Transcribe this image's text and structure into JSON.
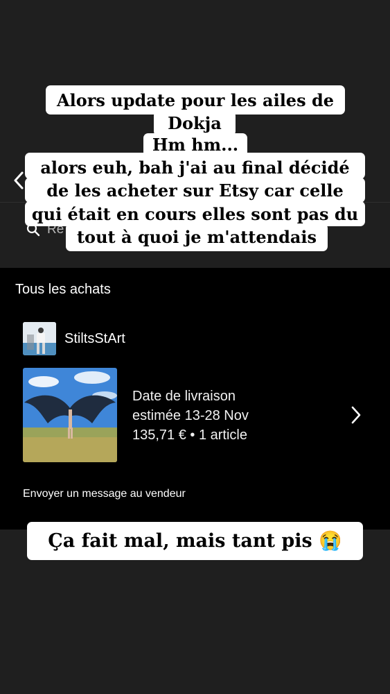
{
  "search": {
    "placeholder_visible": "Re"
  },
  "orders": {
    "section_title": "Tous les achats",
    "shop_name": "StiltsStArt",
    "delivery_line_1": "Date de livraison",
    "delivery_line_2": "estimée 13-28 Nov",
    "price_line": "135,71 € • 1 article",
    "message_seller": "Envoyer un message au vendeur"
  },
  "captions": {
    "line_1": "Alors update pour les ailes de",
    "line_2": "Dokja",
    "line_3": "Hm hm...",
    "line_4": "alors euh, bah j'ai au final décidé",
    "line_5": "de les acheter sur Etsy car celle",
    "line_6": "qui était en cours elles sont pas du",
    "line_7": "tout à quoi je m'attendais",
    "bottom": "Ça fait mal, mais tant pis 😭"
  },
  "icons": {
    "back": "chevron-left-icon",
    "search": "search-icon",
    "order_open": "chevron-right-icon"
  },
  "colors": {
    "background": "#1f1f1f",
    "panel": "#000000",
    "text": "#ffffff",
    "caption_bg": "#ffffff"
  }
}
